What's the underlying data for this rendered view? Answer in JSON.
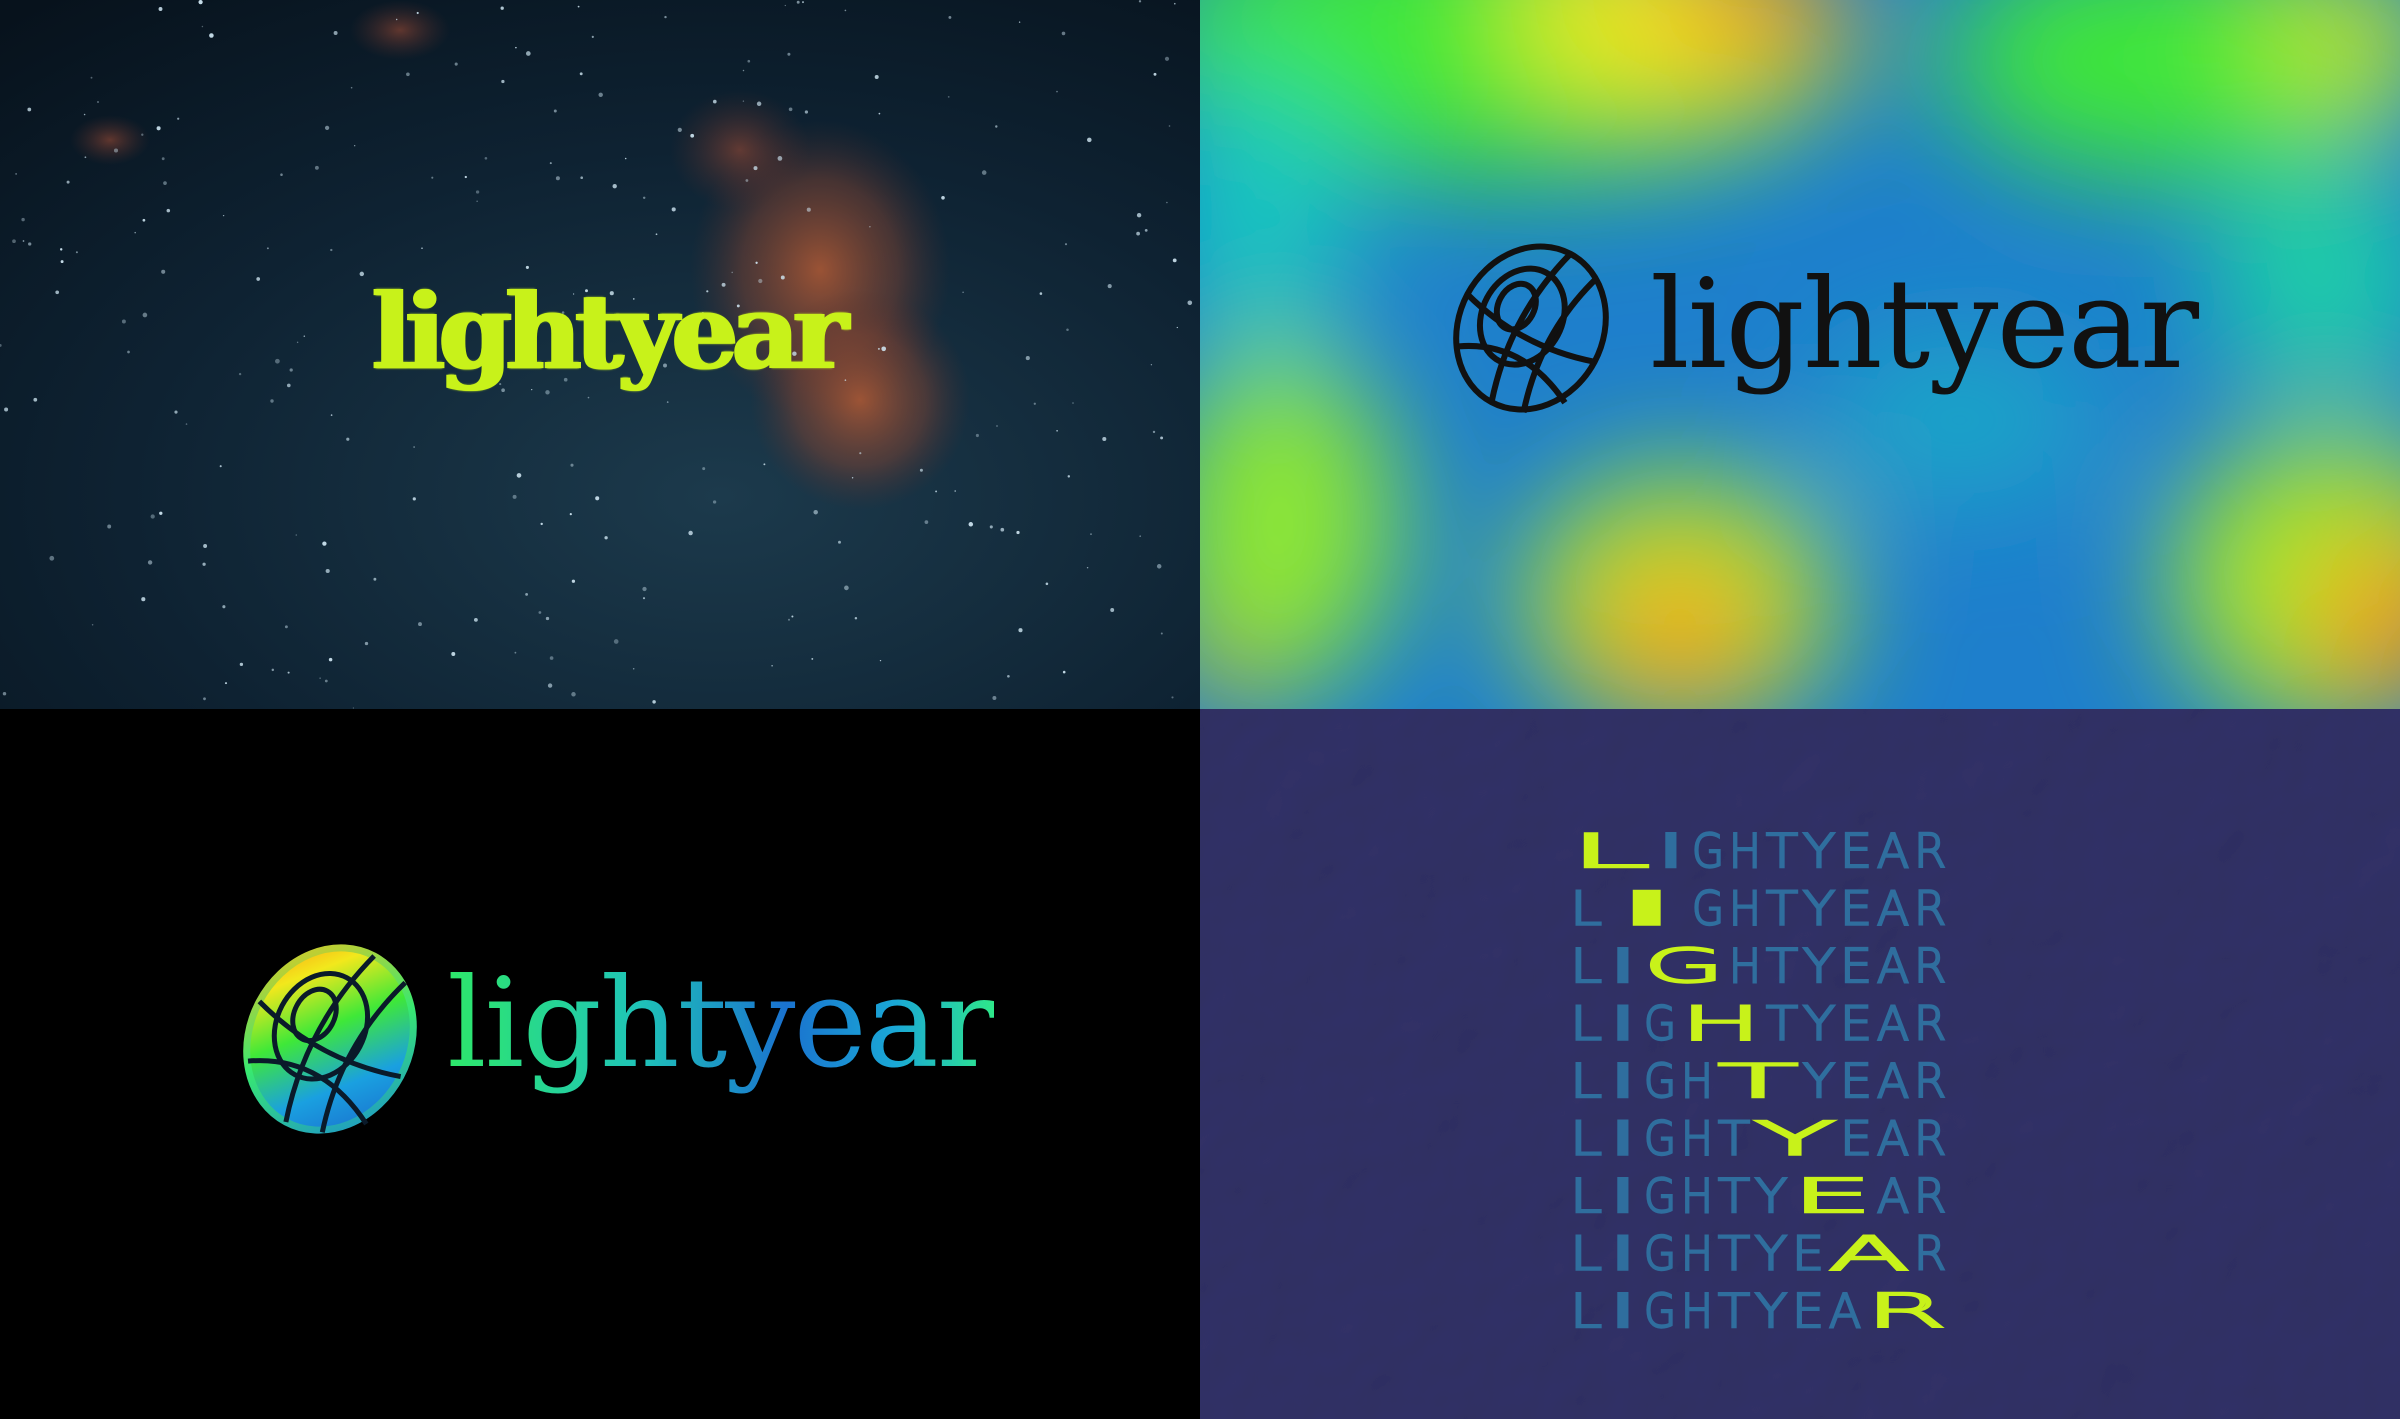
{
  "panels": [
    {
      "id": "starfield",
      "wordmark": "lightyear",
      "colors": {
        "text": "#c8f21a",
        "bg": "#0b1c2b"
      }
    },
    {
      "id": "heatmap",
      "wordmark": "lightyear",
      "colors": {
        "text": "#111111"
      }
    },
    {
      "id": "gradient-on-black",
      "wordmark": "lightyear",
      "colors": {
        "bg": "#000000"
      }
    },
    {
      "id": "letter-stack",
      "colors": {
        "bg": "#2b2a5a",
        "text": "#2f6e9e",
        "highlight": "#c8f21a"
      },
      "word": "LIGHTYEAR",
      "rows": [
        {
          "text": "LIGHTYEAR",
          "highlight": 0
        },
        {
          "text": "LIGHTYEAR",
          "highlight": 1
        },
        {
          "text": "LIGHTYEAR",
          "highlight": 2
        },
        {
          "text": "LIGHTYEAR",
          "highlight": 3
        },
        {
          "text": "LIGHTYEAR",
          "highlight": 4
        },
        {
          "text": "LIGHTYEAR",
          "highlight": 5
        },
        {
          "text": "LIGHTYEAR",
          "highlight": 6
        },
        {
          "text": "LIGHTYEAR",
          "highlight": 7
        },
        {
          "text": "LIGHTYEAR",
          "highlight": 8
        }
      ]
    }
  ],
  "icons": [
    "torus-logo-icon"
  ]
}
